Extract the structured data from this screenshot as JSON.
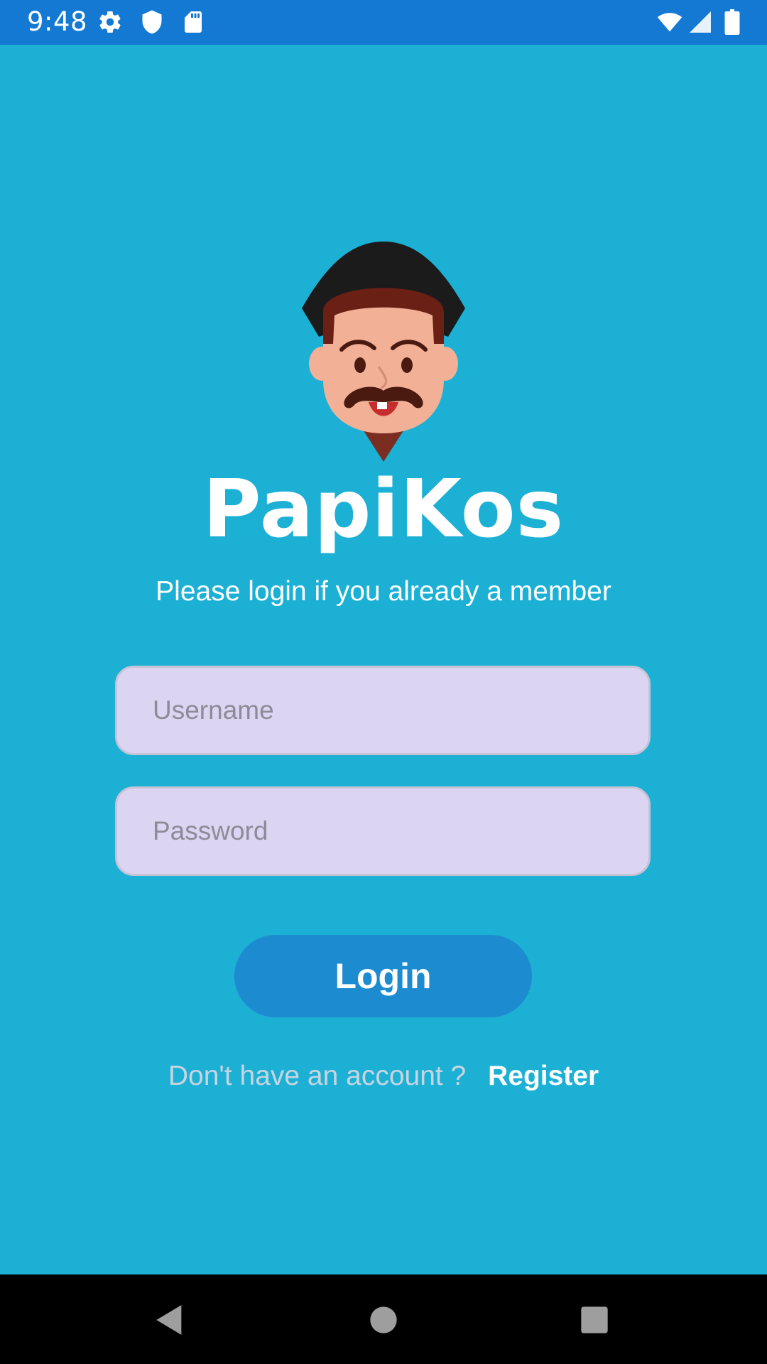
{
  "status_bar": {
    "time": "9:48",
    "icons": [
      "gear-icon",
      "shield-icon",
      "sd-card-icon",
      "wifi-icon",
      "signal-icon",
      "battery-icon"
    ],
    "background": "#1479D2"
  },
  "app": {
    "title": "PapiKos",
    "subtitle": "Please login if you already a member",
    "logo": "mascot-logo",
    "background": "#1CB0D5"
  },
  "form": {
    "username_placeholder": "Username",
    "username_value": "",
    "password_placeholder": "Password",
    "password_value": "",
    "login_label": "Login",
    "field_color": "#DCD5F2",
    "button_color": "#1C8BD0"
  },
  "register": {
    "prompt": "Don't have an account ?",
    "link_label": "Register"
  },
  "nav_bar": {
    "icons": [
      "back-icon",
      "home-icon",
      "recents-icon"
    ]
  }
}
